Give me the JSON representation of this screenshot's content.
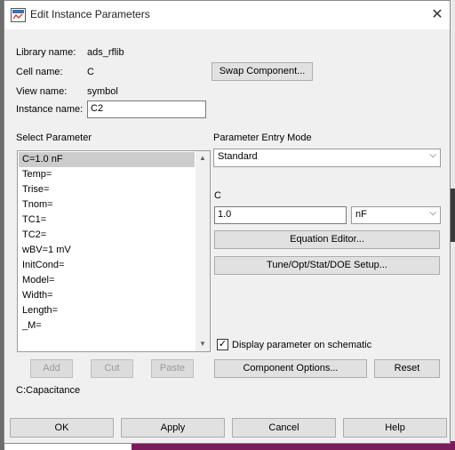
{
  "window": {
    "title": "Edit Instance Parameters",
    "close_glyph": "✕"
  },
  "info": {
    "library_label": "Library name:",
    "library_value": "ads_rflib",
    "cell_label": "Cell name:",
    "cell_value": "C",
    "view_label": "View name:",
    "view_value": "symbol",
    "instance_label": "Instance name:",
    "instance_value": "C2"
  },
  "buttons": {
    "swap_component": "Swap Component...",
    "equation_editor": "Equation Editor...",
    "tune_setup": "Tune/Opt/Stat/DOE Setup...",
    "add": "Add",
    "cut": "Cut",
    "paste": "Paste",
    "component_options": "Component Options...",
    "reset": "Reset",
    "ok": "OK",
    "apply": "Apply",
    "cancel": "Cancel",
    "help": "Help"
  },
  "select_parameter": {
    "heading": "Select Parameter",
    "items": [
      "C=1.0 nF",
      "Temp=",
      "Trise=",
      "Tnom=",
      "TC1=",
      "TC2=",
      "wBV=1 mV",
      "InitCond=",
      "Model=",
      "Width=",
      "Length=",
      "_M="
    ],
    "selected_index": 0
  },
  "entry_mode": {
    "heading": "Parameter Entry Mode",
    "value": "Standard"
  },
  "param_edit": {
    "name": "C",
    "value": "1.0",
    "unit": "nF"
  },
  "display_checkbox": {
    "label": "Display parameter on schematic",
    "checked": true,
    "check_glyph": "✓"
  },
  "description": "C:Capacitance",
  "icons": {
    "title": "ads-window-icon",
    "close": "close-icon",
    "dropdown": "chevron-down-icon"
  },
  "colors": {
    "selected_item": "#cccccc",
    "dialog_bg": "#f0f0f0"
  }
}
